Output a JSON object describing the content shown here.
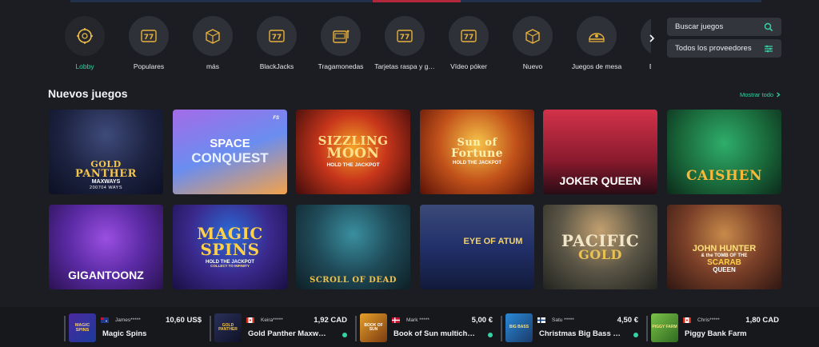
{
  "categories": [
    {
      "label": "Lobby",
      "icon": "lobby-icon",
      "active": true
    },
    {
      "label": "Populares",
      "icon": "slot-777-icon"
    },
    {
      "label": "más",
      "icon": "box-icon"
    },
    {
      "label": "BlackJacks",
      "icon": "slot-777-icon"
    },
    {
      "label": "Tragamonedas",
      "icon": "slot-machine-icon"
    },
    {
      "label": "Tarjetas raspa y g…",
      "icon": "slot-777-icon"
    },
    {
      "label": "Vídeo póker",
      "icon": "slot-777-icon"
    },
    {
      "label": "Nuevo",
      "icon": "box-icon"
    },
    {
      "label": "Juegos de mesa",
      "icon": "casino-table-icon"
    },
    {
      "label": "Big T…",
      "icon": "slot-777-icon"
    }
  ],
  "search": {
    "label": "Buscar juegos"
  },
  "providers": {
    "label": "Todos los proveedores"
  },
  "section": {
    "title": "Nuevos juegos",
    "show_all": "Mostrar todo"
  },
  "games": [
    {
      "t1": "GOLD",
      "t2": "PANTHER",
      "t3": "MAXWAYS",
      "t4": "200704 WAYS"
    },
    {
      "t1": "SPACE",
      "t2": "CONQUEST",
      "t3": "FS",
      "t4": ""
    },
    {
      "t1": "SIZZLING",
      "t2": "MOON",
      "t3": "HOLD THE JACKPOT",
      "t4": ""
    },
    {
      "t1": "Sun of",
      "t2": "Fortune",
      "t3": "HOLD THE JACKPOT",
      "t4": ""
    },
    {
      "t1": "JOKER",
      "t2": "QUEEN",
      "t3": "",
      "t4": ""
    },
    {
      "t1": "CAISHEN",
      "t2": "",
      "t3": "",
      "t4": ""
    },
    {
      "t1": "GIGANTOONZ",
      "t2": "",
      "t3": "",
      "t4": ""
    },
    {
      "t1": "MAGIC",
      "t2": "SPINS",
      "t3": "HOLD THE JACKPOT",
      "t4": "COLLECT TO INFINITY"
    },
    {
      "t1": "SCROLL OF DEAD",
      "t2": "",
      "t3": "",
      "t4": ""
    },
    {
      "t1": "EYE OF ATUM",
      "t2": "",
      "t3": "",
      "t4": ""
    },
    {
      "t1": "PACIFIC",
      "t2": "GOLD",
      "t3": "",
      "t4": ""
    },
    {
      "t1": "JOHN HUNTER",
      "t2": "& the TOMB OF THE",
      "t3": "SCARAB",
      "t4": "QUEEN"
    }
  ],
  "wins": [
    {
      "user": "James*****",
      "amount": "10,60 US$",
      "game": "Magic Spins",
      "flag": "au"
    },
    {
      "user": "Keira*****",
      "amount": "1,92 CAD",
      "game": "Gold Panther Maxw…",
      "flag": "ca"
    },
    {
      "user": "Mark *****",
      "amount": "5,00 €",
      "game": "Book of Sun multich…",
      "flag": "dk"
    },
    {
      "user": "Satu *****",
      "amount": "4,50 €",
      "game": "Christmas Big Bass …",
      "flag": "fi"
    },
    {
      "user": "Chris*****",
      "amount": "1,80 CAD",
      "game": "Piggy Bank Farm",
      "flag": "ca"
    }
  ],
  "thumb_labels": [
    "MAGIC SPINS",
    "GOLD PANTHER",
    "BOOK OF SUN",
    "BIG BASS",
    "PIGGY FARM"
  ],
  "colors": {
    "accent": "#35d3a4",
    "bg": "#1c1d22",
    "bar": "#17181c"
  }
}
